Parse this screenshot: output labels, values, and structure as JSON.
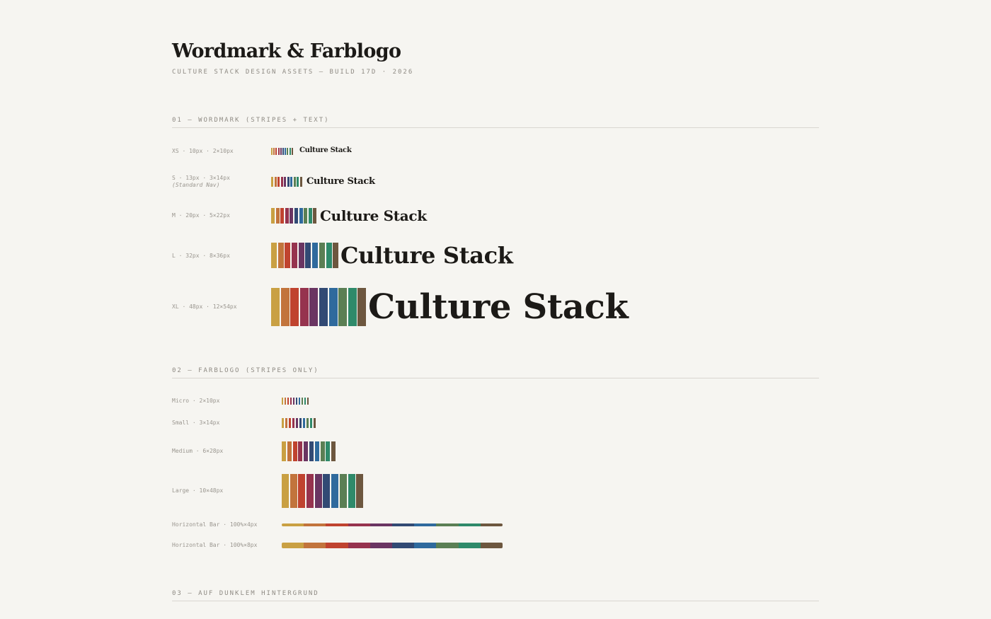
{
  "header": {
    "title": "Wordmark & Farblogo",
    "subtitle": "CULTURE STACK DESIGN ASSETS — BUILD 17D · 2026"
  },
  "palette": [
    "#c9a043",
    "#c2743c",
    "#c0432f",
    "#96334e",
    "#6a3562",
    "#324a74",
    "#2f6a9d",
    "#5b7f54",
    "#2f8a6a",
    "#6d573f"
  ],
  "wordmark_text": "Culture Stack",
  "sections": {
    "wordmark": {
      "heading": "01 — WORDMARK (STRIPES + TEXT)",
      "rows": [
        {
          "label": "XS · 10px · 2×10px",
          "note": ""
        },
        {
          "label": "S · 13px · 3×14px",
          "note": "(Standard Nav)"
        },
        {
          "label": "M · 20px · 5×22px",
          "note": ""
        },
        {
          "label": "L · 32px · 8×36px",
          "note": ""
        },
        {
          "label": "XL · 48px · 12×54px",
          "note": ""
        }
      ]
    },
    "farblogo": {
      "heading": "02 — FARBLOGO (STRIPES ONLY)",
      "rows": [
        {
          "label": "Micro · 2×10px"
        },
        {
          "label": "Small · 3×14px"
        },
        {
          "label": "Medium · 6×28px"
        },
        {
          "label": "Large · 10×48px"
        },
        {
          "label": "Horizontal Bar · 100%×4px"
        },
        {
          "label": "Horizontal Bar · 100%×8px"
        }
      ]
    },
    "dark": {
      "heading": "03 — AUF DUNKLEM HINTERGRUND"
    }
  }
}
